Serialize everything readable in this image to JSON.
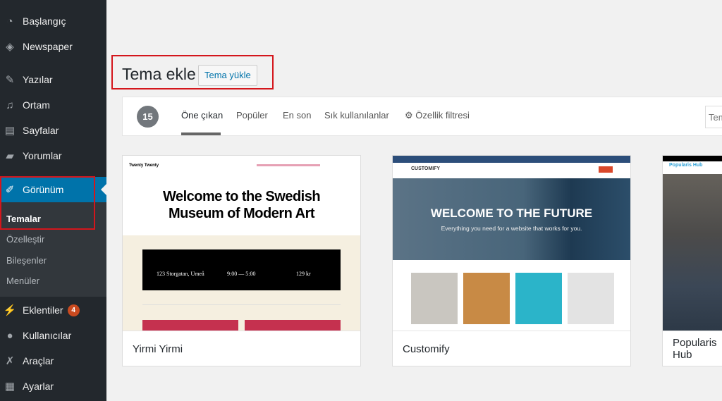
{
  "sidebar": {
    "items": [
      {
        "label": "Başlangıç",
        "icon": "dashboard-icon"
      },
      {
        "label": "Newspaper",
        "icon": "newspaper-icon"
      },
      {
        "label": "Yazılar",
        "icon": "pin-icon"
      },
      {
        "label": "Ortam",
        "icon": "media-icon"
      },
      {
        "label": "Sayfalar",
        "icon": "pages-icon"
      },
      {
        "label": "Yorumlar",
        "icon": "comment-icon"
      },
      {
        "label": "Görünüm",
        "icon": "brush-icon",
        "active": true
      },
      {
        "label": "Eklentiler",
        "icon": "plugin-icon",
        "badge": "4"
      },
      {
        "label": "Kullanıcılar",
        "icon": "user-icon"
      },
      {
        "label": "Araçlar",
        "icon": "wrench-icon"
      },
      {
        "label": "Ayarlar",
        "icon": "settings-icon"
      }
    ],
    "submenu": [
      "Temalar",
      "Özelleştir",
      "Bileşenler",
      "Menüler"
    ]
  },
  "header": {
    "title": "Tema ekle",
    "upload_label": "Tema yükle"
  },
  "filter": {
    "count": "15",
    "tabs": [
      "Öne çıkan",
      "Popüler",
      "En son",
      "Sık kullanılanlar"
    ],
    "feature_filter": "Özellik filtresi",
    "search_placeholder": "Tema ara..."
  },
  "themes": [
    {
      "name": "Yirmi Yirmi",
      "shot": {
        "site": "Twenty Twenty",
        "headline1": "Welcome to the Swedish",
        "headline2": "Museum of Modern Art",
        "info": [
          "123 Storgatan, Umeå",
          "9:00 — 5:00",
          "129 kr"
        ]
      }
    },
    {
      "name": "Customify",
      "shot": {
        "logo": "CUSTOMIFY",
        "headline": "WELCOME TO THE FUTURE",
        "sub": "Everything you need for a website that works for you."
      }
    },
    {
      "name": "Popularis Hub",
      "shot": {
        "logo": "Popularis Hub"
      }
    }
  ],
  "colors": {
    "sidebar": "#23282d",
    "active": "#0073aa",
    "highlight": "#d4161c"
  }
}
